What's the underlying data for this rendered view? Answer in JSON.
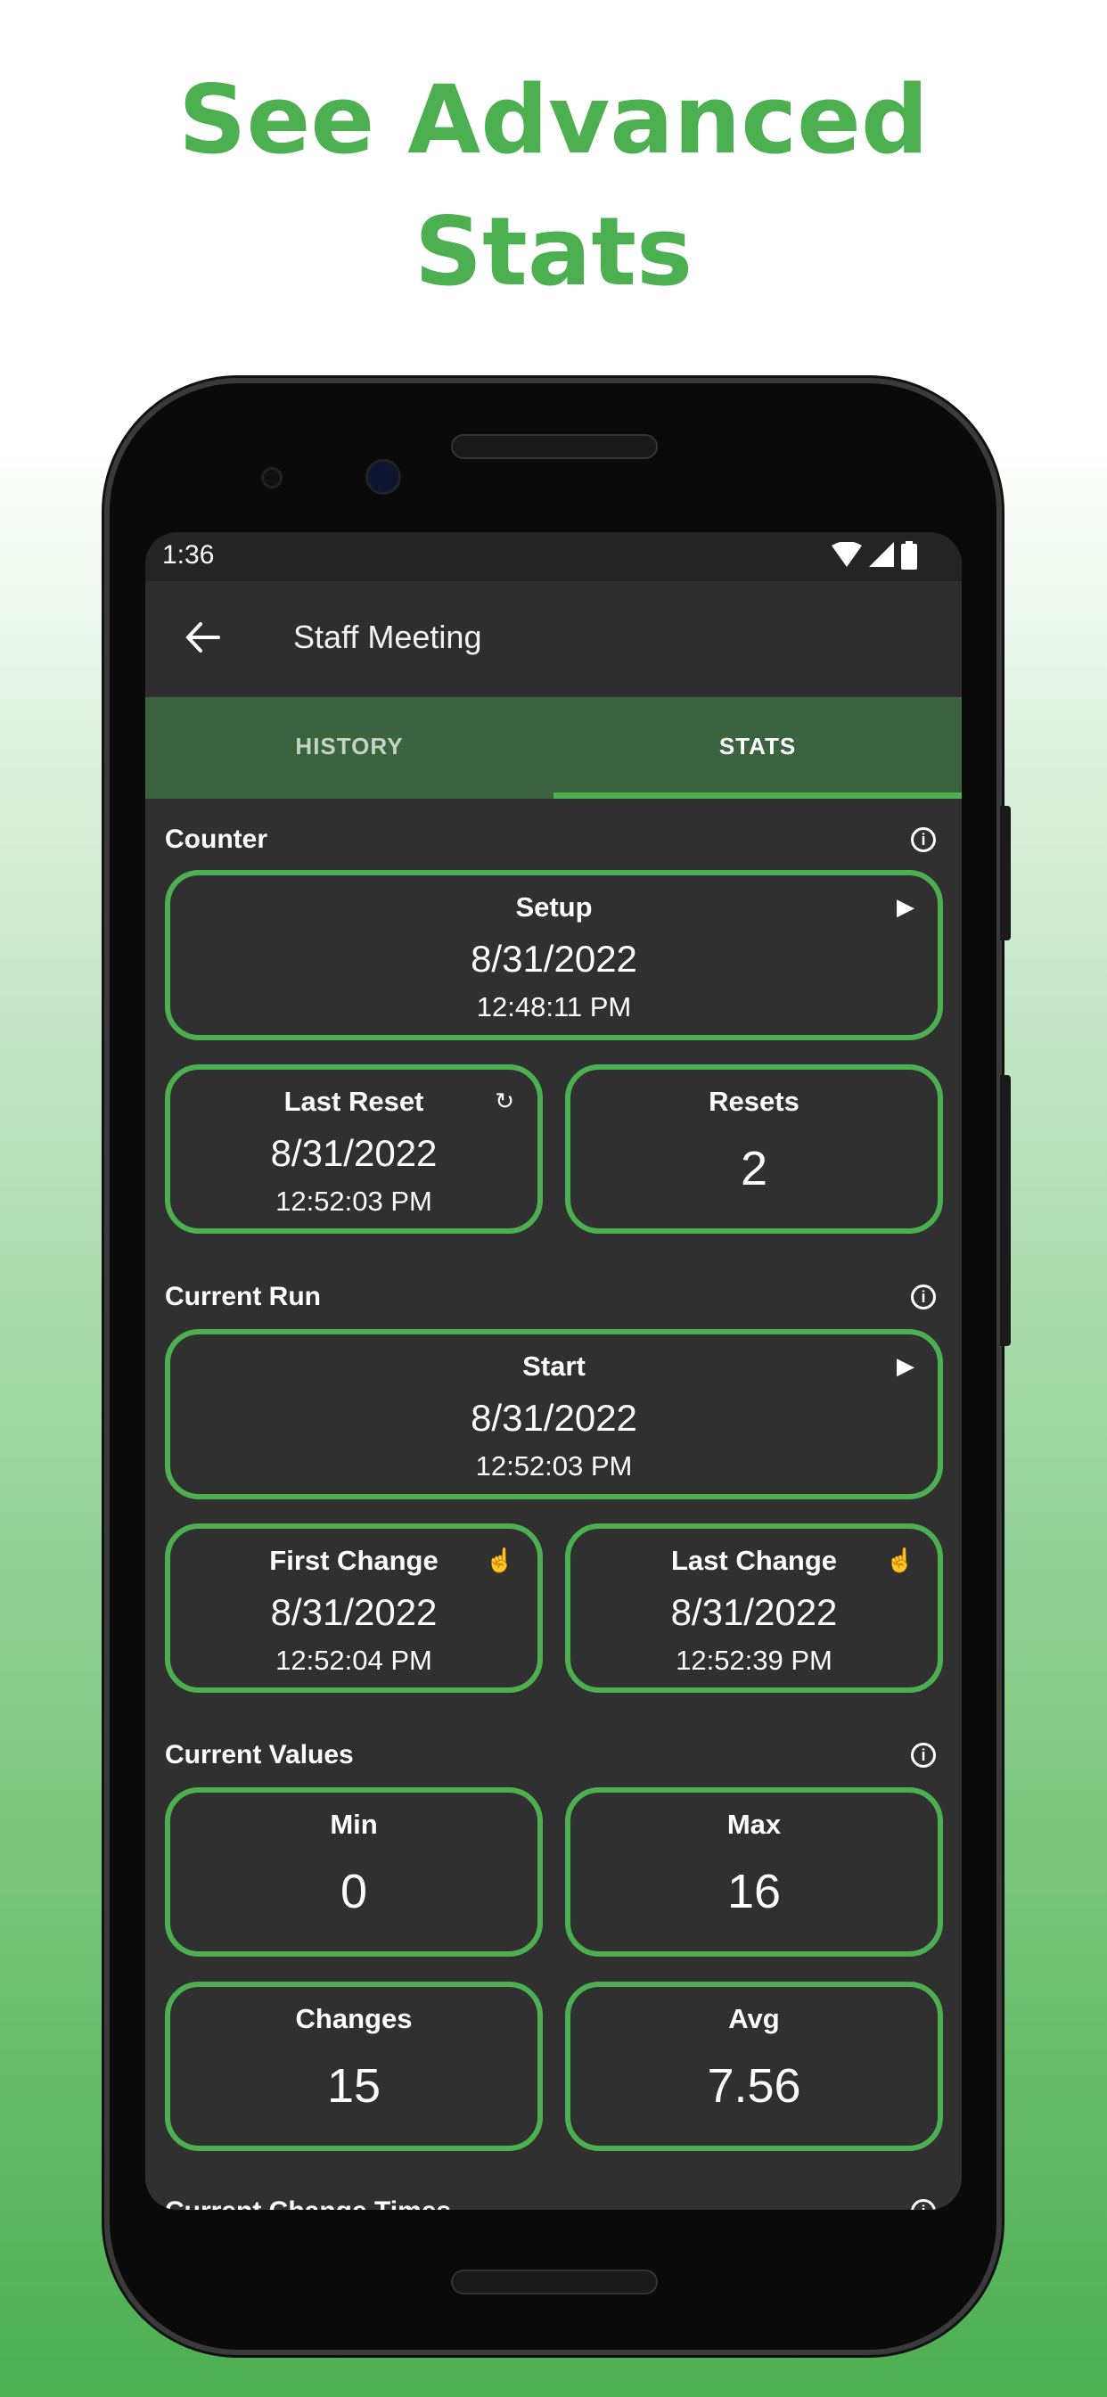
{
  "headline": {
    "line1": "See Advanced",
    "line2": "Stats"
  },
  "colors": {
    "accent": "#4caf50",
    "tab_bar": "#3c6340",
    "background": "#303030",
    "app_bar": "#2e2e2e"
  },
  "status_bar": {
    "time": "1:36",
    "icons": [
      "wifi-icon",
      "signal-icon",
      "battery-icon"
    ]
  },
  "app_bar": {
    "title": "Staff Meeting",
    "back_icon": "arrow-left-icon"
  },
  "tabs": [
    {
      "label": "HISTORY",
      "active": false
    },
    {
      "label": "STATS",
      "active": true
    }
  ],
  "sections": {
    "counter": {
      "label": "Counter",
      "setup": {
        "title": "Setup",
        "date": "8/31/2022",
        "time": "12:48:11 PM",
        "icon": "play-icon"
      },
      "last_reset": {
        "title": "Last Reset",
        "date": "8/31/2022",
        "time": "12:52:03 PM",
        "icon": "refresh-icon"
      },
      "resets": {
        "title": "Resets",
        "value": "2"
      }
    },
    "current_run": {
      "label": "Current Run",
      "start": {
        "title": "Start",
        "date": "8/31/2022",
        "time": "12:52:03 PM",
        "icon": "play-icon"
      },
      "first_change": {
        "title": "First Change",
        "date": "8/31/2022",
        "time": "12:52:04 PM",
        "icon": "tap-icon"
      },
      "last_change": {
        "title": "Last Change",
        "date": "8/31/2022",
        "time": "12:52:39 PM",
        "icon": "tap-icon"
      }
    },
    "current_values": {
      "label": "Current Values",
      "min": {
        "title": "Min",
        "value": "0"
      },
      "max": {
        "title": "Max",
        "value": "16"
      },
      "changes": {
        "title": "Changes",
        "value": "15"
      },
      "avg": {
        "title": "Avg",
        "value": "7.56"
      }
    },
    "current_change_times": {
      "label": "Current Change Times"
    }
  }
}
